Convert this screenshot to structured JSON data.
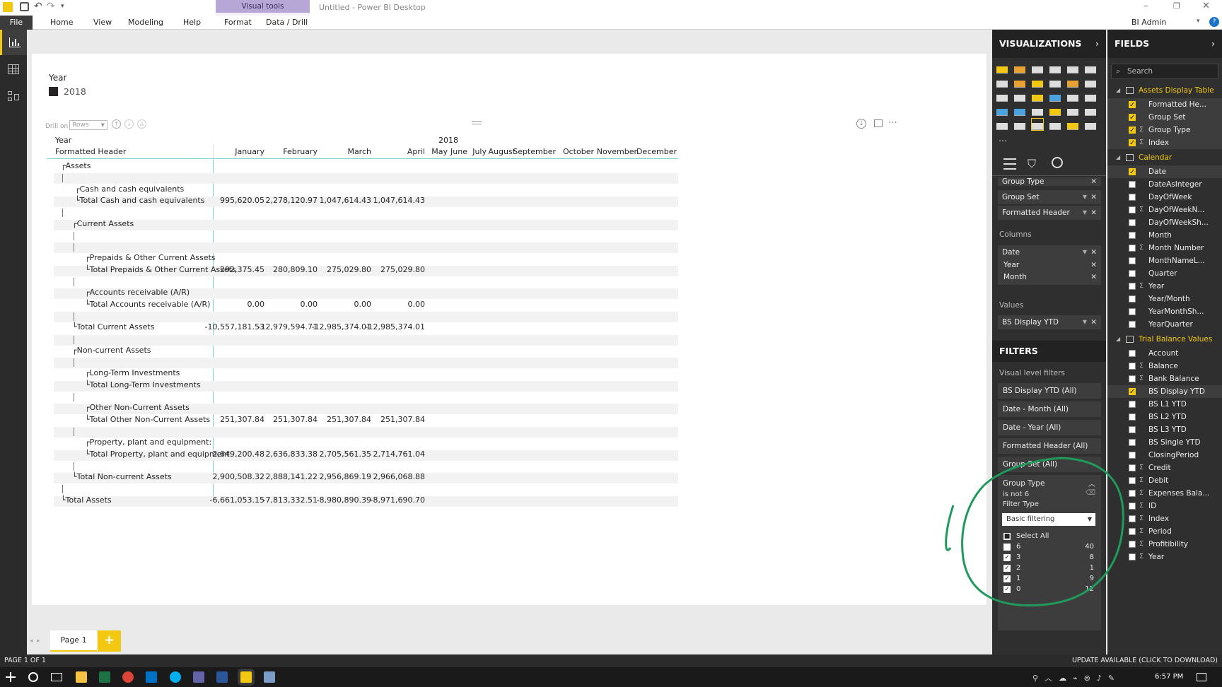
{
  "window": {
    "title": "Untitled - Power BI Desktop",
    "user": "BI Admin",
    "visual_tools": "Visual tools"
  },
  "ribbon": {
    "tabs": [
      "File",
      "Home",
      "View",
      "Modeling",
      "Help",
      "Format",
      "Data / Drill"
    ]
  },
  "slicer": {
    "title": "Year",
    "value": "2018"
  },
  "matrix": {
    "drill_on": "Drill on",
    "drill_select": "Rows",
    "header_year_label": "Year",
    "header_year_value": "2018",
    "header_row_label": "Formatted Header",
    "months": [
      "January",
      "February",
      "March",
      "April",
      "May",
      "June",
      "July",
      "August",
      "September",
      "October",
      "November",
      "December"
    ],
    "rows": [
      {
        "label": "Assets",
        "vals": [
          "",
          "",
          "",
          ""
        ]
      },
      {
        "label": "",
        "vals": [
          "",
          "",
          "",
          ""
        ]
      },
      {
        "label": "Cash and cash equivalents",
        "vals": [
          "",
          "",
          "",
          ""
        ]
      },
      {
        "label": "Total Cash and cash equivalents",
        "vals": [
          "995,620.05",
          "2,278,120.97",
          "1,047,614.43",
          "1,047,614.43"
        ]
      },
      {
        "label": "",
        "vals": [
          "",
          "",
          "",
          ""
        ]
      },
      {
        "label": "Current Assets",
        "vals": [
          "",
          "",
          "",
          ""
        ]
      },
      {
        "label": "",
        "vals": [
          "",
          "",
          "",
          ""
        ]
      },
      {
        "label": "",
        "vals": [
          "",
          "",
          "",
          ""
        ]
      },
      {
        "label": "Prepaids & Other Current Assets",
        "vals": [
          "",
          "",
          "",
          ""
        ]
      },
      {
        "label": "Total Prepaids & Other Current Assets",
        "vals": [
          "292,375.45",
          "280,809.10",
          "275,029.80",
          "275,029.80"
        ]
      },
      {
        "label": "",
        "vals": [
          "",
          "",
          "",
          ""
        ]
      },
      {
        "label": "Accounts receivable (A/R)",
        "vals": [
          "",
          "",
          "",
          ""
        ]
      },
      {
        "label": "Total Accounts receivable (A/R)",
        "vals": [
          "0.00",
          "0.00",
          "0.00",
          "0.00"
        ]
      },
      {
        "label": "",
        "vals": [
          "",
          "",
          "",
          ""
        ]
      },
      {
        "label": "Total Current Assets",
        "vals": [
          "-10,557,181.53",
          "-12,979,594.71",
          "-12,985,374.01",
          "-12,985,374.01"
        ]
      },
      {
        "label": "",
        "vals": [
          "",
          "",
          "",
          ""
        ]
      },
      {
        "label": "Non-current Assets",
        "vals": [
          "",
          "",
          "",
          ""
        ]
      },
      {
        "label": "",
        "vals": [
          "",
          "",
          "",
          ""
        ]
      },
      {
        "label": "Long-Term Investments",
        "vals": [
          "",
          "",
          "",
          ""
        ]
      },
      {
        "label": "Total Long-Term Investments",
        "vals": [
          "",
          "",
          "",
          ""
        ]
      },
      {
        "label": "",
        "vals": [
          "",
          "",
          "",
          ""
        ]
      },
      {
        "label": "Other Non-Current Assets",
        "vals": [
          "",
          "",
          "",
          ""
        ]
      },
      {
        "label": "Total Other Non-Current Assets",
        "vals": [
          "251,307.84",
          "251,307.84",
          "251,307.84",
          "251,307.84"
        ]
      },
      {
        "label": "",
        "vals": [
          "",
          "",
          "",
          ""
        ]
      },
      {
        "label": "Property, plant and equipment:",
        "vals": [
          "",
          "",
          "",
          ""
        ]
      },
      {
        "label": "Total Property, plant and equipment:",
        "vals": [
          "2,649,200.48",
          "2,636,833.38",
          "2,705,561.35",
          "2,714,761.04"
        ]
      },
      {
        "label": "",
        "vals": [
          "",
          "",
          "",
          ""
        ]
      },
      {
        "label": "Total Non-current Assets",
        "vals": [
          "2,900,508.32",
          "2,888,141.22",
          "2,956,869.19",
          "2,966,068.88"
        ]
      },
      {
        "label": "",
        "vals": [
          "",
          "",
          "",
          ""
        ]
      },
      {
        "label": "Total Assets",
        "vals": [
          "-6,661,053.15",
          "-7,813,332.51",
          "-8,980,890.39",
          "-8,971,690.70"
        ]
      }
    ]
  },
  "page_tabs": {
    "page1": "Page 1",
    "add": "+"
  },
  "visualizations": {
    "title": "VISUALIZATIONS",
    "wells": {
      "rows": [
        "Group Type",
        "Group Set",
        "Formatted Header"
      ],
      "columns_label": "Columns",
      "columns": [
        "Date",
        "Year",
        "Month"
      ],
      "values_label": "Values",
      "values": [
        "BS Display YTD"
      ]
    }
  },
  "filters": {
    "title": "FILTERS",
    "visual_level": "Visual level filters",
    "cards": [
      "BS Display YTD (All)",
      "Date - Month (All)",
      "Date - Year (All)",
      "Formatted Header (All)",
      "Group Set (All)"
    ],
    "expanded": {
      "name": "Group Type",
      "condition": "is not 6",
      "filter_type_label": "Filter Type",
      "filter_type": "Basic filtering",
      "select_all": "Select All",
      "items": [
        {
          "value": "6",
          "count": "40",
          "checked": false
        },
        {
          "value": "3",
          "count": "8",
          "checked": true
        },
        {
          "value": "2",
          "count": "1",
          "checked": true
        },
        {
          "value": "1",
          "count": "9",
          "checked": true
        },
        {
          "value": "0",
          "count": "12",
          "checked": true
        }
      ]
    }
  },
  "fields": {
    "title": "FIELDS",
    "search_placeholder": "Search",
    "tables": [
      {
        "name": "Assets Display Table",
        "fields": [
          {
            "name": "Formatted He...",
            "checked": true,
            "sigma": false
          },
          {
            "name": "Group Set",
            "checked": true,
            "sigma": false
          },
          {
            "name": "Group Type",
            "checked": true,
            "sigma": true
          },
          {
            "name": "Index",
            "checked": true,
            "sigma": true
          }
        ]
      },
      {
        "name": "Calendar",
        "fields": [
          {
            "name": "Date",
            "checked": true,
            "sigma": false
          },
          {
            "name": "DateAsInteger",
            "checked": false,
            "sigma": false
          },
          {
            "name": "DayOfWeek",
            "checked": false,
            "sigma": false
          },
          {
            "name": "DayOfWeekN...",
            "checked": false,
            "sigma": true
          },
          {
            "name": "DayOfWeekSh...",
            "checked": false,
            "sigma": false
          },
          {
            "name": "Month",
            "checked": false,
            "sigma": false
          },
          {
            "name": "Month Number",
            "checked": false,
            "sigma": true
          },
          {
            "name": "MonthNameL...",
            "checked": false,
            "sigma": false
          },
          {
            "name": "Quarter",
            "checked": false,
            "sigma": false
          },
          {
            "name": "Year",
            "checked": false,
            "sigma": true
          },
          {
            "name": "Year/Month",
            "checked": false,
            "sigma": false
          },
          {
            "name": "YearMonthSh...",
            "checked": false,
            "sigma": false
          },
          {
            "name": "YearQuarter",
            "checked": false,
            "sigma": false
          }
        ]
      },
      {
        "name": "Trial Balance Values",
        "fields": [
          {
            "name": "Account",
            "checked": false,
            "sigma": false
          },
          {
            "name": "Balance",
            "checked": false,
            "sigma": true
          },
          {
            "name": "Bank Balance",
            "checked": false,
            "sigma": true
          },
          {
            "name": "BS Display YTD",
            "checked": true,
            "sigma": false
          },
          {
            "name": "BS L1 YTD",
            "checked": false,
            "sigma": false
          },
          {
            "name": "BS L2 YTD",
            "checked": false,
            "sigma": false
          },
          {
            "name": "BS L3 YTD",
            "checked": false,
            "sigma": false
          },
          {
            "name": "BS Single YTD",
            "checked": false,
            "sigma": false
          },
          {
            "name": "ClosingPeriod",
            "checked": false,
            "sigma": false
          },
          {
            "name": "Credit",
            "checked": false,
            "sigma": true
          },
          {
            "name": "Debit",
            "checked": false,
            "sigma": true
          },
          {
            "name": "Expenses Bala...",
            "checked": false,
            "sigma": true
          },
          {
            "name": "ID",
            "checked": false,
            "sigma": true
          },
          {
            "name": "Index",
            "checked": false,
            "sigma": true
          },
          {
            "name": "Period",
            "checked": false,
            "sigma": true
          },
          {
            "name": "Profitibility",
            "checked": false,
            "sigma": true
          },
          {
            "name": "Year",
            "checked": false,
            "sigma": true
          }
        ]
      }
    ]
  },
  "status": {
    "page": "PAGE 1 OF 1",
    "update": "UPDATE AVAILABLE (CLICK TO DOWNLOAD)"
  },
  "taskbar": {
    "time": "6:57 PM"
  },
  "colors": {
    "accent": "#f2c811",
    "teal": "#7fd3d3",
    "annotation": "#1f9a5a"
  }
}
